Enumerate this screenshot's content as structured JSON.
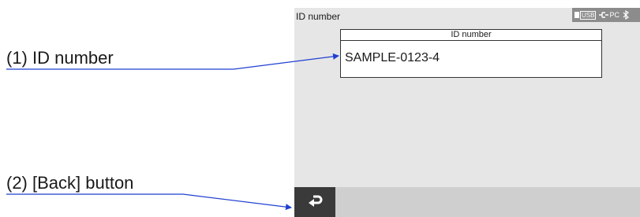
{
  "callouts": {
    "id_number": "(1) ID number",
    "back_button": "(2) [Back] button"
  },
  "screen": {
    "title": "ID number",
    "status": {
      "usb_label": "USB",
      "pc_label": "PC",
      "icons": [
        "usb-icon",
        "pc-connection-icon",
        "bluetooth-icon"
      ]
    },
    "id_field": {
      "header": "ID number",
      "value": "SAMPLE-0123-4"
    },
    "back_button_icon": "back-arrow-icon"
  },
  "colors": {
    "screen_bg": "#e6e6e6",
    "bottom_bar": "#cfcfcf",
    "back_button": "#3a3a3a",
    "leader_line": "#1f3fd1"
  }
}
